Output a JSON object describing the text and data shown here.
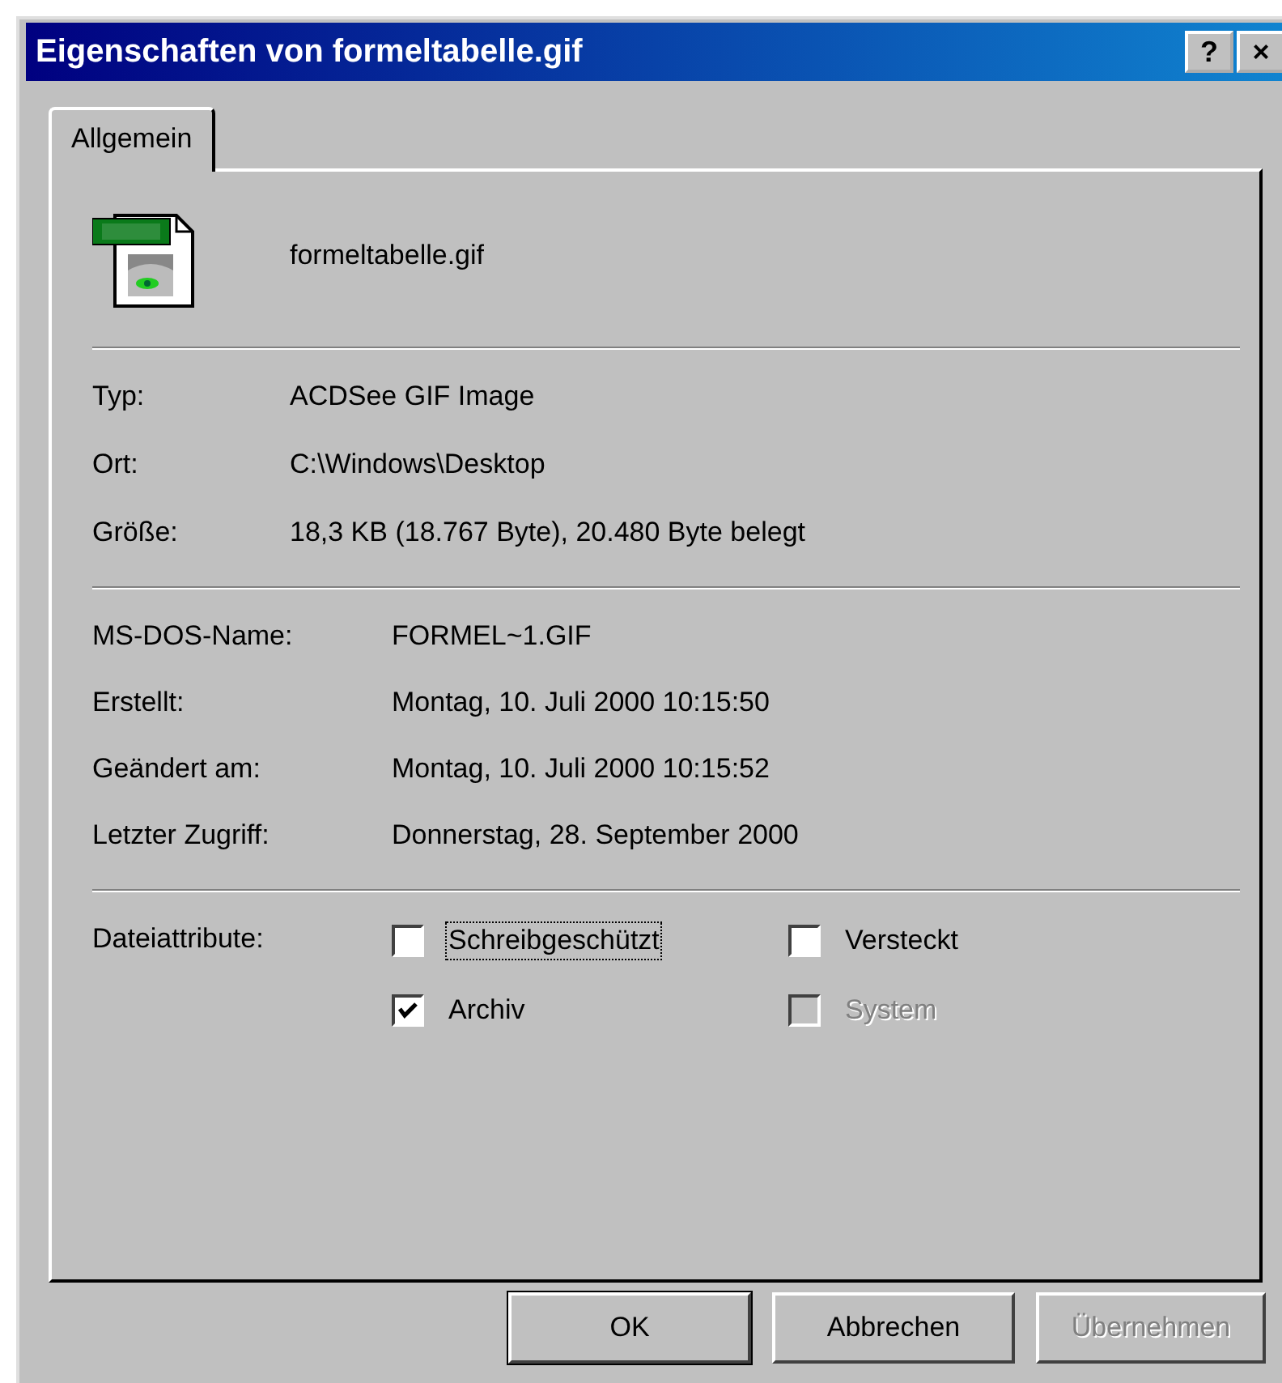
{
  "window": {
    "title": "Eigenschaften von formeltabelle.gif",
    "title_buttons": [
      "?",
      "×"
    ]
  },
  "tabs": [
    {
      "label": "Allgemein",
      "selected": true
    }
  ],
  "file": {
    "name": "formeltabelle.gif"
  },
  "details": [
    {
      "label": "Typ:",
      "value": "ACDSee GIF Image"
    },
    {
      "label": "Ort:",
      "value": "C:\\Windows\\Desktop"
    },
    {
      "label": "Größe:",
      "value": "18,3 KB (18.767 Byte), 20.480 Byte belegt"
    }
  ],
  "dates": [
    {
      "label": "MS-DOS-Name:",
      "value": "FORMEL~1.GIF"
    },
    {
      "label": "Erstellt:",
      "value": "Montag, 10. Juli 2000 10:15:50"
    },
    {
      "label": "Geändert am:",
      "value": "Montag, 10. Juli 2000 10:15:52"
    },
    {
      "label": "Letzter Zugriff:",
      "value": "Donnerstag, 28. September 2000"
    }
  ],
  "attributes": {
    "label": "Dateiattribute:",
    "items": [
      {
        "label": "Schreibgeschützt",
        "checked": false,
        "disabled": false,
        "focused": true
      },
      {
        "label": "Versteckt",
        "checked": false,
        "disabled": false,
        "focused": false
      },
      {
        "label": "Archiv",
        "checked": true,
        "disabled": false,
        "focused": false
      },
      {
        "label": "System",
        "checked": false,
        "disabled": true,
        "focused": false
      }
    ]
  },
  "buttons": [
    {
      "label": "OK",
      "default": true,
      "disabled": false
    },
    {
      "label": "Abbrechen",
      "default": false,
      "disabled": false
    },
    {
      "label": "Übernehmen",
      "default": false,
      "disabled": true
    }
  ]
}
